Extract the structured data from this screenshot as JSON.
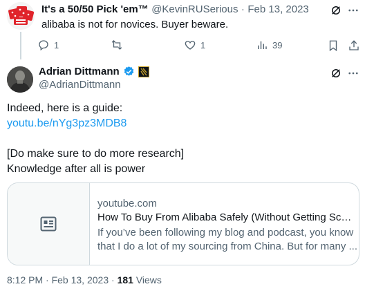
{
  "reply_tweet": {
    "name": "It's a 50/50 Pick 'em™",
    "handle": "@KevinRUSerious",
    "separator": "·",
    "date": "Feb 13, 2023",
    "text": "alibaba is not for novices. Buyer beware.",
    "actions": {
      "replies": "1",
      "retweets": "",
      "likes": "1",
      "views": "39"
    }
  },
  "main_tweet": {
    "name": "Adrian Dittmann",
    "handle": "@AdrianDittmann",
    "line1": "Indeed, here is a guide:",
    "link": "youtu.be/nYg3pz3MDB8",
    "line2": "[Do make sure to do more research]",
    "line3": "Knowledge after all is power",
    "card": {
      "domain": "youtube.com",
      "title": "How To Buy From Alibaba Safely (Without Getting Scamm...",
      "desc_line1": "If you’ve been following my blog and podcast, you know",
      "desc_line2": "that I do a lot of my sourcing from China. But for many ..."
    },
    "time": "8:12 PM",
    "date": "Feb 13, 2023",
    "separator": "·",
    "views_count": "181",
    "views_label": "Views"
  },
  "colors": {
    "accent": "#1d9bf0",
    "muted": "#536471",
    "border": "#cfd9de",
    "verified": "#1d9bf0"
  },
  "icons": [
    "grok-icon",
    "more-icon",
    "reply-icon",
    "retweet-icon",
    "like-icon",
    "views-icon",
    "bookmark-icon",
    "share-icon",
    "verified-badge-icon",
    "affiliate-badge-icon",
    "article-card-icon"
  ]
}
